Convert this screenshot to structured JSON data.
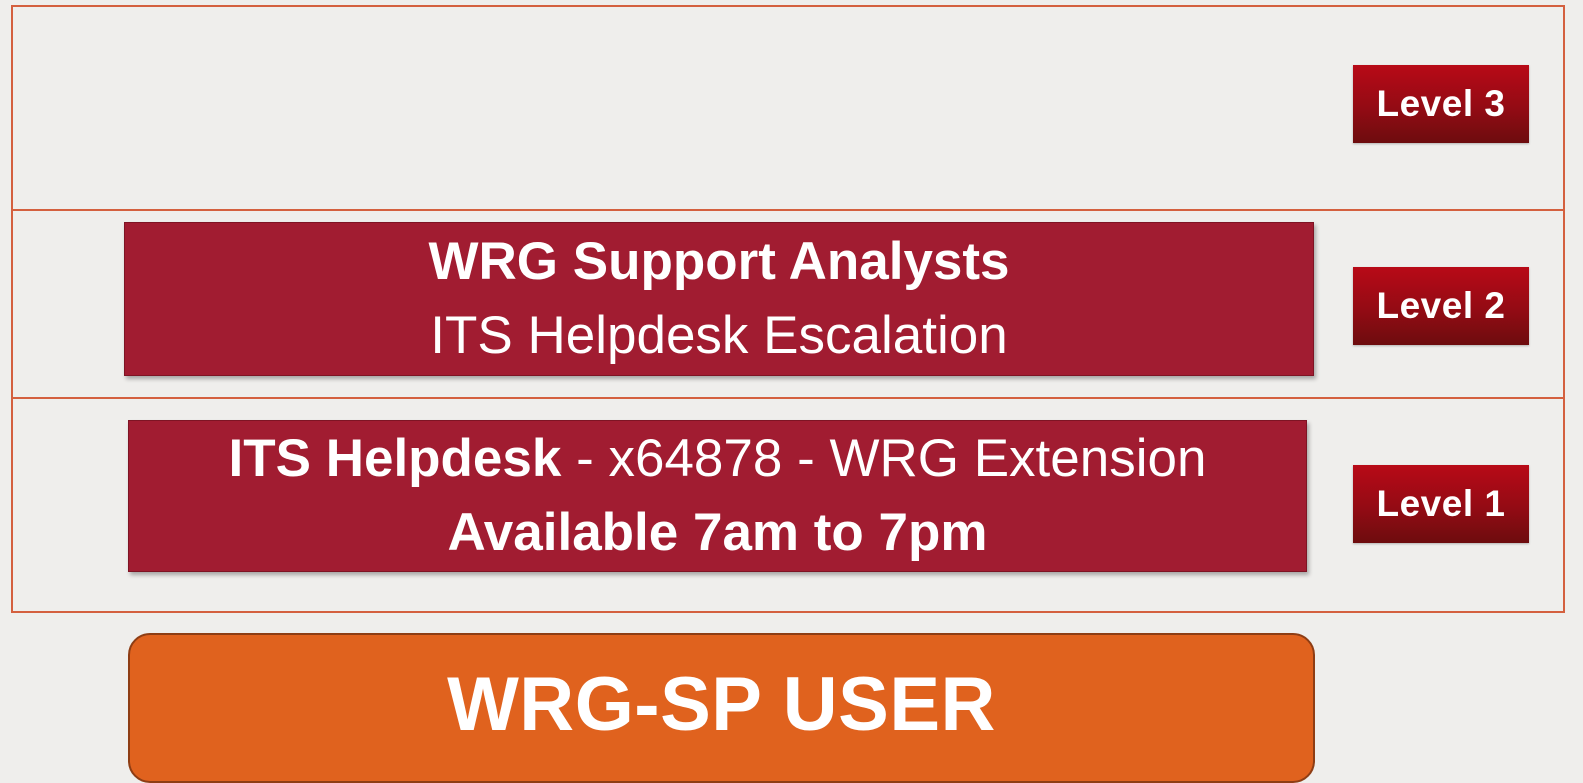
{
  "levels": {
    "level3": "Level 3",
    "level2": "Level 2",
    "level1": "Level 1"
  },
  "level2_card": {
    "title": "WRG Support Analysts",
    "subtitle": "ITS Helpdesk Escalation"
  },
  "level1_card": {
    "name": "ITS Helpdesk",
    "details": " - x64878 - WRG Extension",
    "availability": "Available 7am to 7pm"
  },
  "user_box": {
    "label": "WRG-SP USER"
  },
  "colors": {
    "background": "#efeeec",
    "tier_border": "#d4603f",
    "card_fill": "#a11c31",
    "badge_fill": "#930b14",
    "user_fill": "#e0621e"
  }
}
